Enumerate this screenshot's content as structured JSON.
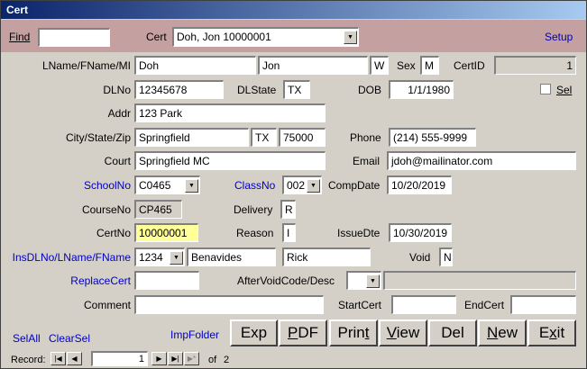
{
  "window": {
    "title": "Cert"
  },
  "header": {
    "find_label": "Find",
    "find_value": "",
    "cert_label": "Cert",
    "cert_value": "Doh, Jon 10000001",
    "setup_link": "Setup"
  },
  "form": {
    "name_label": "LName/FName/MI",
    "lname": "Doh",
    "fname": "Jon",
    "mi": "W",
    "sex_label": "Sex",
    "sex": "M",
    "certid_label": "CertID",
    "certid": "1",
    "dlno_label": "DLNo",
    "dlno": "12345678",
    "dlstate_label": "DLState",
    "dlstate": "TX",
    "dob_label": "DOB",
    "dob": "1/1/1980",
    "sel_label": "Sel",
    "addr_label": "Addr",
    "addr": "123 Park",
    "csz_label": "City/State/Zip",
    "city": "Springfield",
    "state": "TX",
    "zip": "75000",
    "phone_label": "Phone",
    "phone": "(214) 555-9999",
    "court_label": "Court",
    "court": "Springfield MC",
    "email_label": "Email",
    "email": "jdoh@mailinator.com",
    "schoolno_label": "SchoolNo",
    "schoolno": "C0465",
    "classno_label": "ClassNo",
    "classno": "002",
    "compdate_label": "CompDate",
    "compdate": "10/20/2019",
    "courseno_label": "CourseNo",
    "courseno": "CP465",
    "delivery_label": "Delivery",
    "delivery": "R",
    "certno_label": "CertNo",
    "certno": "10000001",
    "reason_label": "Reason",
    "reason": "I",
    "issuedte_label": "IssueDte",
    "issuedte": "10/30/2019",
    "ins_label": "InsDLNo/LName/FName",
    "ins_dlno": "1234",
    "ins_lname": "Benavides",
    "ins_fname": "Rick",
    "void_label": "Void",
    "void": "N",
    "replacecert_label": "ReplaceCert",
    "replacecert": "",
    "aftervoid_label": "AfterVoidCode/Desc",
    "aftervoid_code": "",
    "aftervoid_desc": "",
    "comment_label": "Comment",
    "comment": "",
    "startcert_label": "StartCert",
    "startcert": "",
    "endcert_label": "EndCert",
    "endcert": ""
  },
  "links": {
    "selall": "SelAll",
    "clearsel": "ClearSel",
    "impfolder": "ImpFolder"
  },
  "buttons": [
    {
      "name": "exp-button",
      "pre": "Exp",
      "u": "",
      "post": ""
    },
    {
      "name": "pdf-button",
      "pre": "",
      "u": "P",
      "post": "DF"
    },
    {
      "name": "print-button",
      "pre": "Prin",
      "u": "t",
      "post": ""
    },
    {
      "name": "view-button",
      "pre": "",
      "u": "V",
      "post": "iew"
    },
    {
      "name": "del-button",
      "pre": "Del",
      "u": "",
      "post": ""
    },
    {
      "name": "new-button",
      "pre": "",
      "u": "N",
      "post": "ew"
    },
    {
      "name": "exit-button",
      "pre": "E",
      "u": "x",
      "post": "it"
    }
  ],
  "record_nav": {
    "label": "Record:",
    "current": "1",
    "of_label": "of",
    "total": "2"
  }
}
